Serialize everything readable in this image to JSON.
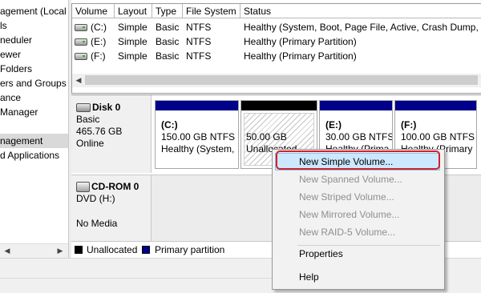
{
  "tree": {
    "items": [
      {
        "label": "agement (Local",
        "selected": false
      },
      {
        "label": "ls",
        "selected": false
      },
      {
        "label": "neduler",
        "selected": false
      },
      {
        "label": "ewer",
        "selected": false
      },
      {
        "label": "Folders",
        "selected": false
      },
      {
        "label": "ers and Groups",
        "selected": false
      },
      {
        "label": "ance",
        "selected": false
      },
      {
        "label": "Manager",
        "selected": false
      },
      {
        "label": "",
        "selected": false
      },
      {
        "label": "nagement",
        "selected": true
      },
      {
        "label": "d Applications",
        "selected": false
      }
    ],
    "scroll_left": "◀",
    "scroll_right": "▶"
  },
  "volume_list": {
    "columns": [
      "Volume",
      "Layout",
      "Type",
      "File System",
      "Status"
    ],
    "rows": [
      {
        "volume": "(C:)",
        "layout": "Simple",
        "type": "Basic",
        "fs": "NTFS",
        "status": "Healthy (System, Boot, Page File, Active, Crash Dump, P"
      },
      {
        "volume": "(E:)",
        "layout": "Simple",
        "type": "Basic",
        "fs": "NTFS",
        "status": "Healthy (Primary Partition)"
      },
      {
        "volume": "(F:)",
        "layout": "Simple",
        "type": "Basic",
        "fs": "NTFS",
        "status": "Healthy (Primary Partition)"
      }
    ],
    "scroll_left": "◀"
  },
  "disks": {
    "disk0": {
      "name": "Disk 0",
      "type": "Basic",
      "size": "465.76 GB",
      "status": "Online",
      "partitions": [
        {
          "name": "(C:)",
          "size": "150.00 GB NTFS",
          "status": "Healthy (System,"
        },
        {
          "name": "",
          "size": "50.00 GB",
          "status": "Unallocated"
        },
        {
          "name": "(E:)",
          "size": "30.00 GB NTFS",
          "status": "Healthy (Prima"
        },
        {
          "name": "(F:)",
          "size": "100.00 GB NTFS",
          "status": "Healthy (Primary"
        }
      ]
    },
    "cdrom0": {
      "name": "CD-ROM 0",
      "type": "DVD (H:)",
      "media": "No Media"
    }
  },
  "legend": {
    "unallocated": "Unallocated",
    "primary": "Primary partition"
  },
  "context_menu": {
    "items": [
      {
        "label": "New Simple Volume...",
        "enabled": true,
        "highlighted": true
      },
      {
        "label": "New Spanned Volume...",
        "enabled": false
      },
      {
        "label": "New Striped Volume...",
        "enabled": false
      },
      {
        "label": "New Mirrored Volume...",
        "enabled": false
      },
      {
        "label": "New RAID-5 Volume...",
        "enabled": false
      },
      {
        "label": "Properties",
        "enabled": true
      },
      {
        "label": "Help",
        "enabled": true
      }
    ]
  },
  "colors": {
    "primary_partition": "#00008b",
    "unallocated": "#000000",
    "highlight_ring": "#d3202a",
    "menu_highlight": "#cce8ff"
  }
}
